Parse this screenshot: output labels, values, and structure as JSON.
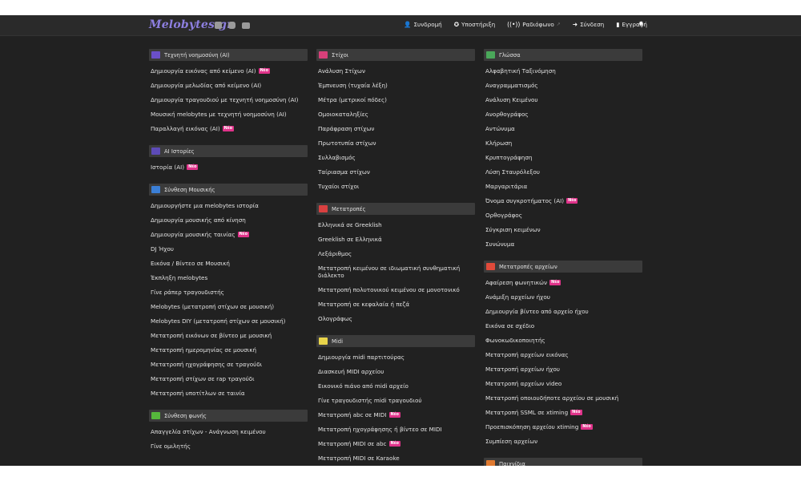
{
  "brand": {
    "logo": "Melobytes.gr"
  },
  "social": [
    {
      "name": "facebook-icon"
    },
    {
      "name": "instagram-icon"
    },
    {
      "name": "youtube-icon"
    }
  ],
  "nav": [
    {
      "icon": "user-plus-icon",
      "glyph": "👤",
      "label": "Συνδρομή"
    },
    {
      "icon": "support-icon",
      "glyph": "✪",
      "label": "Υποστήριξη"
    },
    {
      "icon": "radio-icon",
      "glyph": "((•))",
      "label": "Ραδιόφωνο"
    },
    {
      "icon": "login-icon",
      "glyph": "➜",
      "label": "Σύνδεση"
    },
    {
      "icon": "clipboard-icon",
      "glyph": "▮",
      "label": "Εγγραφή"
    }
  ],
  "colors": {
    "accent": "#8d7fe0",
    "badge": "#e0338a",
    "background": "#212121",
    "section_header": "#3b3b3b"
  },
  "badge_label": "Νέο",
  "columns": [
    [
      {
        "title": "Τεχνητή νοημοσύνη (AI)",
        "icon": "ai-icon",
        "color": "#6a4fc8",
        "items": [
          {
            "label": "Δημιουργία εικόνας από κείμενο (AI)",
            "new": true
          },
          {
            "label": "Δημιουργία μελωδίας από κείμενο (AI)"
          },
          {
            "label": "Δημιουργία τραγουδιού με τεχνητή νοημοσύνη (AI)"
          },
          {
            "label": "Μουσική melobytes με τεχνητή νοημοσύνη (AI)"
          },
          {
            "label": "Παραλλαγή εικόνας (AI)",
            "new": true
          }
        ]
      },
      {
        "title": "AI Ιστορίες",
        "icon": "story-icon",
        "color": "#5d4bb8",
        "items": [
          {
            "label": "Ιστορία (AI)",
            "new": true
          }
        ]
      },
      {
        "title": "Σύνθεση Μουσικής",
        "icon": "music-note-icon",
        "color": "#3b7fd6",
        "items": [
          {
            "label": "Δημιουργήστε μια melobytes ιστορία"
          },
          {
            "label": "Δημιουργία μουσικής από κίνηση"
          },
          {
            "label": "Δημιουργία μουσικής ταινίας",
            "new": true
          },
          {
            "label": "DJ Ήχου"
          },
          {
            "label": "Εικόνα / Βίντεο σε Μουσική"
          },
          {
            "label": "Έκπληξη melobytes"
          },
          {
            "label": "Γίνε ράπερ τραγουδιστής"
          },
          {
            "label": "Melobytes (μετατροπή στίχων σε μουσική)"
          },
          {
            "label": "Melobytes DIY (μετατροπή στίχων σε μουσική)"
          },
          {
            "label": "Μετατροπή εικόνων σε βίντεο με μουσική"
          },
          {
            "label": "Μετατροπή ημερομηνίας σε μουσική"
          },
          {
            "label": "Μετατροπή ηχογράφησης σε τραγούδι"
          },
          {
            "label": "Μετατροπή στίχων σε rap τραγούδι"
          },
          {
            "label": "Μετατροπή υποτίτλων σε ταινία"
          }
        ]
      },
      {
        "title": "Σύνθεση φωνής",
        "icon": "play-icon",
        "color": "#56b83c",
        "items": [
          {
            "label": "Απαγγελία στίχων - Ανάγνωση κειμένου"
          },
          {
            "label": "Γίνε ομιλητής"
          }
        ]
      }
    ],
    [
      {
        "title": "Στίχοι",
        "icon": "pen-icon",
        "color": "#d8407a",
        "items": [
          {
            "label": "Ανάλυση Στίχων"
          },
          {
            "label": "Έμπνευση (τυχαία λέξη)"
          },
          {
            "label": "Μέτρα (μετρικοί πόδες)"
          },
          {
            "label": "Ομοιοκαταληξίες"
          },
          {
            "label": "Παράφραση στίχων"
          },
          {
            "label": "Πρωτοτυπία στίχων"
          },
          {
            "label": "Συλλαβισμός"
          },
          {
            "label": "Ταίριασμα στίχων"
          },
          {
            "label": "Τυχαίοι στίχοι"
          }
        ]
      },
      {
        "title": "Μετατροπές",
        "icon": "swap-icon",
        "color": "#d94040",
        "items": [
          {
            "label": "Ελληνικά σε Greeklish"
          },
          {
            "label": "Greeklish σε Ελληνικά"
          },
          {
            "label": "Λεξάριθμος"
          },
          {
            "label": "Μετατροπή κειμένου σε ιδιωματική συνθηματική διάλεκτο"
          },
          {
            "label": "Μετατροπή πολυτονικού κειμένου σε μονοτονικό"
          },
          {
            "label": "Μετατροπή σε κεφαλαία ή πεζά"
          },
          {
            "label": "Ολογράφως"
          }
        ]
      },
      {
        "title": "Midi",
        "icon": "file-icon",
        "color": "#e8d44a",
        "items": [
          {
            "label": "Δημιουργία midi παρτιτούρας"
          },
          {
            "label": "Διασκευή MIDI αρχείου"
          },
          {
            "label": "Εικονικό πιάνο από midi αρχείο"
          },
          {
            "label": "Γίνε τραγουδιστής midi τραγουδιού"
          },
          {
            "label": "Μετατροπή abc σε MIDI",
            "new": true
          },
          {
            "label": "Μετατροπή ηχογράφησης ή βίντεο σε MIDI"
          },
          {
            "label": "Μετατροπή MIDI σε abc",
            "new": true
          },
          {
            "label": "Μετατροπή MIDI σε Karaoke"
          }
        ]
      }
    ],
    [
      {
        "title": "Γλώσσα",
        "icon": "keyboard-icon",
        "color": "#4aa85a",
        "items": [
          {
            "label": "Αλφαβητική Ταξινόμηση"
          },
          {
            "label": "Αναγραμματισμός"
          },
          {
            "label": "Ανάλυση Κειμένου"
          },
          {
            "label": "Ανορθογράφος"
          },
          {
            "label": "Αντώνυμα"
          },
          {
            "label": "Κλήρωση"
          },
          {
            "label": "Κρυπτογράφηση"
          },
          {
            "label": "Λύση Σταυρόλεξου"
          },
          {
            "label": "Μαργαριτάρια"
          },
          {
            "label": "Όνομα συγκροτήματος (AI)",
            "new": true
          },
          {
            "label": "Ορθογράφος"
          },
          {
            "label": "Σύγκριση κειμένων"
          },
          {
            "label": "Συνώνυμα"
          }
        ]
      },
      {
        "title": "Μετατροπές αρχείων",
        "icon": "file-export-icon",
        "color": "#e04a3a",
        "items": [
          {
            "label": "Αφαίρεση φωνητικών",
            "new": true
          },
          {
            "label": "Ανάμιξη αρχείων ήχου"
          },
          {
            "label": "Δημιουργία βίντεο από αρχείο ήχου"
          },
          {
            "label": "Εικόνα σε σχέδιο"
          },
          {
            "label": "Φωνοκωδικοποιητής"
          },
          {
            "label": "Μετατροπή αρχείων εικόνας"
          },
          {
            "label": "Μετατροπή αρχείων ήχου"
          },
          {
            "label": "Μετατροπή αρχείων video"
          },
          {
            "label": "Μετατροπή οποιουδήποτε αρχείου σε μουσική"
          },
          {
            "label": "Μετατροπή SSML σε xtiming",
            "new": true
          },
          {
            "label": "Προεπισκόπηση αρχείου xtiming",
            "new": true
          },
          {
            "label": "Συμπίεση αρχείων"
          }
        ]
      },
      {
        "title": "Παιχνίδια",
        "icon": "game-icon",
        "color": "#e07a30",
        "items": []
      }
    ]
  ]
}
